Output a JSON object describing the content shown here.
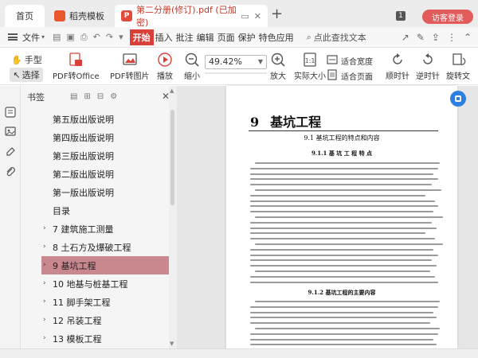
{
  "tabs": {
    "home": "首页",
    "template": "稻壳模板",
    "document": "第二分册(修订).pdf (已加密)",
    "add": "+"
  },
  "header": {
    "count_badge": "1",
    "login_button": "访客登录"
  },
  "menubar": {
    "file": "文件",
    "items": [
      "开始",
      "插入",
      "批注",
      "编辑",
      "页面",
      "保护",
      "特色应用"
    ],
    "search_text": "点此查找文本"
  },
  "toolbar": {
    "hand": "手型",
    "select": "选择",
    "pdf_to_office": "PDF转Office",
    "pdf_to_image": "PDF转图片",
    "play": "播放",
    "zoom_out": "缩小",
    "zoom_value": "49.42%",
    "zoom_in": "放大",
    "actual_size": "实际大小",
    "fit_width": "适合宽度",
    "fit_page": "适合页面",
    "rotate_cw": "顺时针",
    "rotate_ccw": "逆时针",
    "rotate_doc": "旋转文"
  },
  "bookmarks": {
    "title": "书签",
    "items": [
      {
        "label": "第五版出版说明",
        "type": "child"
      },
      {
        "label": "第四版出版说明",
        "type": "child"
      },
      {
        "label": "第三版出版说明",
        "type": "child"
      },
      {
        "label": "第二版出版说明",
        "type": "child"
      },
      {
        "label": "第一版出版说明",
        "type": "child"
      },
      {
        "label": "目录",
        "type": "child"
      },
      {
        "label": "7 建筑施工测量",
        "type": "parent"
      },
      {
        "label": "8 土石方及爆破工程",
        "type": "parent"
      },
      {
        "label": "9 基坑工程",
        "type": "selected"
      },
      {
        "label": "10 地基与桩基工程",
        "type": "parent"
      },
      {
        "label": "11 脚手架工程",
        "type": "parent"
      },
      {
        "label": "12 吊装工程",
        "type": "parent"
      },
      {
        "label": "13 模板工程",
        "type": "parent"
      }
    ]
  },
  "page": {
    "chapter_num": "9",
    "chapter_title": "基坑工程",
    "section_title": "9.1  基坑工程的特点和内容",
    "subsection1": "9.1.1  基 坑 工 程 特 点",
    "subsection2": "9.1.2  基坑工程的主要内容"
  }
}
